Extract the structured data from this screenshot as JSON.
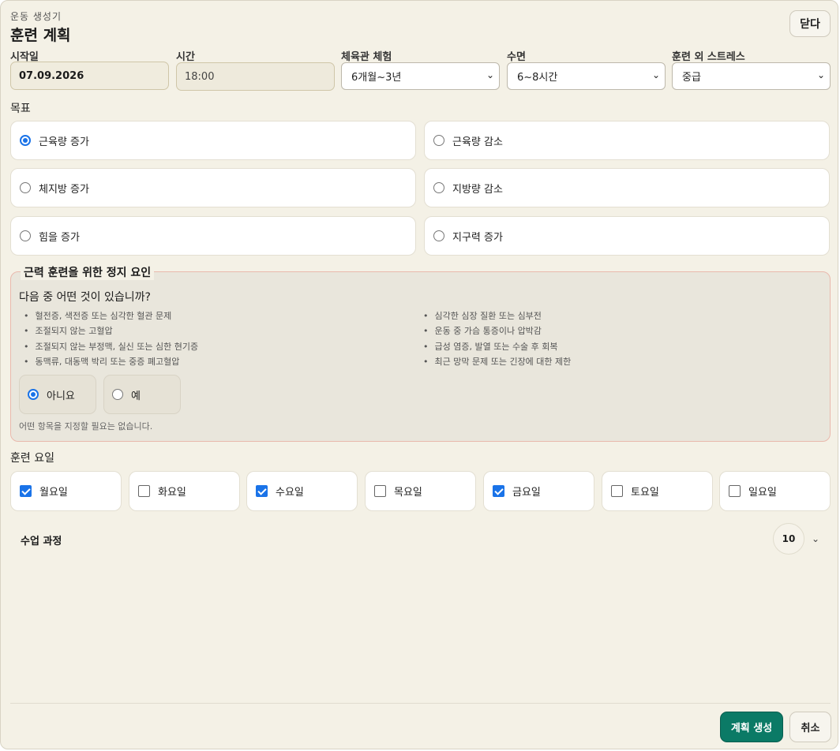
{
  "header": {
    "eyebrow": "운동 생성기",
    "title": "훈련 계획",
    "close_label": "닫다"
  },
  "fields": {
    "start_date": {
      "label": "시작일",
      "value": "07.09.2026"
    },
    "time": {
      "label": "시간",
      "value": "18:00"
    },
    "experience": {
      "label": "체육관 체험",
      "value": "6개월~3년"
    },
    "sleep": {
      "label": "수면",
      "value": "6~8시간"
    },
    "stress": {
      "label": "훈련 외 스트레스",
      "value": "중급"
    }
  },
  "goals": {
    "label": "목표",
    "selected": "근육량 증가",
    "items": [
      "근육량 증가",
      "근육량 감소",
      "체지방 증가",
      "지방량 감소",
      "힘을 증가",
      "지구력 증가"
    ]
  },
  "stop_factors": {
    "title": "근력 훈련을 위한 정지 요인",
    "question": "다음 중 어떤 것이 있습니까?",
    "left": [
      "혈전증, 색전증 또는 심각한 혈관 문제",
      "조절되지 않는 고혈압",
      "조절되지 않는 부정맥, 실신 또는 심한 현기증",
      "동맥류, 대동맥 박리 또는 중증 폐고혈압"
    ],
    "right": [
      "심각한 심장 질환 또는 심부전",
      "운동 중 가슴 통증이나 압박감",
      "급성 염증, 발열 또는 수술 후 회복",
      "최근 망막 문제 또는 긴장에 대한 제한"
    ],
    "no_label": "아니요",
    "yes_label": "예",
    "selected": "아니요",
    "hint": "어떤 항목을 지정할 필요는 없습니다."
  },
  "training_days": {
    "label": "훈련 요일",
    "days": [
      {
        "label": "월요일",
        "checked": true
      },
      {
        "label": "화요일",
        "checked": false
      },
      {
        "label": "수요일",
        "checked": true
      },
      {
        "label": "목요일",
        "checked": false
      },
      {
        "label": "금요일",
        "checked": true
      },
      {
        "label": "토요일",
        "checked": false
      },
      {
        "label": "일요일",
        "checked": false
      }
    ]
  },
  "sessions": {
    "label": "수업 과정",
    "count": "10"
  },
  "footer": {
    "create_label": "계획 생성",
    "cancel_label": "취소"
  },
  "colors": {
    "accent": "#0b7a66",
    "background": "#f4f1e6",
    "check": "#1a73e8",
    "stop_border": "#e9b9ad"
  }
}
